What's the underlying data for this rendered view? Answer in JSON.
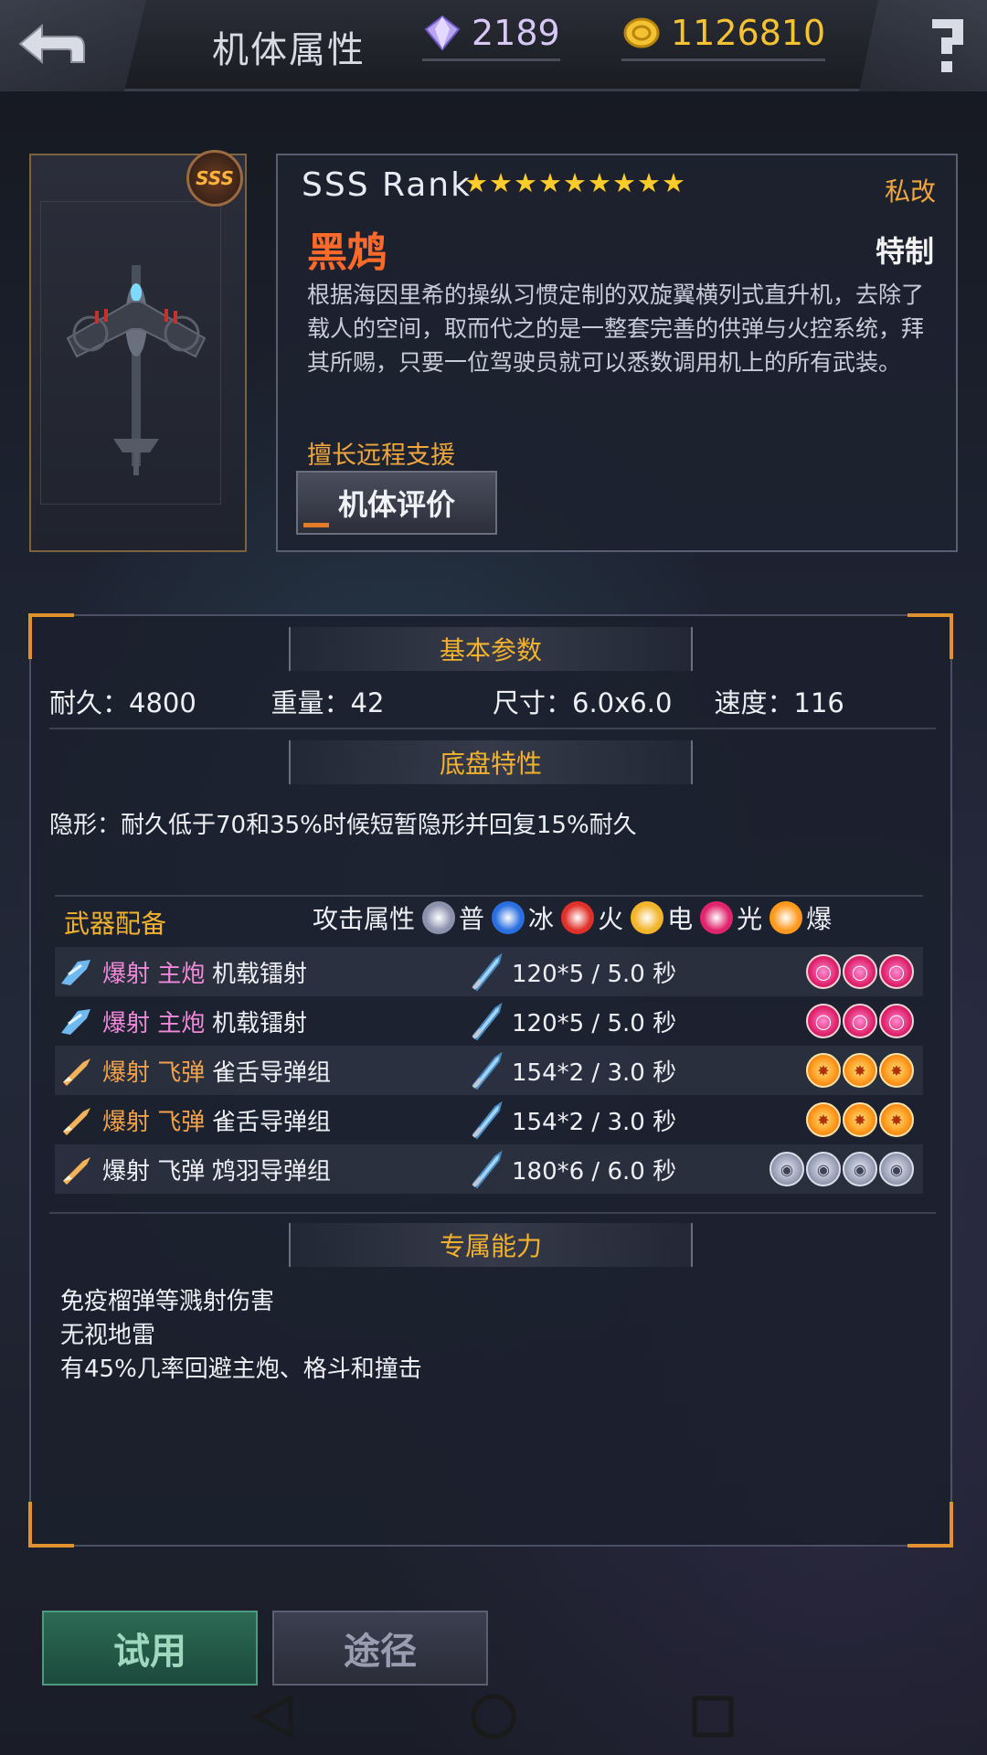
{
  "topbar": {
    "title": "机体属性",
    "gems": "2189",
    "coins": "1126810"
  },
  "unit": {
    "rank_badge": "SSS",
    "rank_text": "SSS Rank",
    "stars": 9,
    "mod_tag": "私改",
    "name": "黑鸩",
    "grade": "特制",
    "description": "根据海因里希的操纵习惯定制的双旋翼横列式直升机，去除了载人的空间，取而代之的是一整套完善的供弹与火控系统，拜其所赐，只要一位驾驶员就可以悉数调用机上的所有武装。",
    "specialty": "擅长远程支援",
    "eval_button": "机体评价"
  },
  "basic": {
    "heading": "基本参数",
    "durability": "耐久：4800",
    "weight": "重量：42",
    "size": "尺寸：6.0x6.0",
    "speed": "速度：116"
  },
  "chassis": {
    "heading": "底盘特性",
    "text": "隐形：耐久低于70和35%时候短暂隐形并回复15%耐久"
  },
  "weapons": {
    "heading": "武器配备",
    "attack_label": "攻击属性",
    "elements": [
      {
        "label": "普",
        "icon": "normal-element-icon",
        "color": "#8c92ad"
      },
      {
        "label": "冰",
        "icon": "ice-element-icon",
        "color": "#2a6fe0"
      },
      {
        "label": "火",
        "icon": "fire-element-icon",
        "color": "#e0302a"
      },
      {
        "label": "电",
        "icon": "electric-element-icon",
        "color": "#f2b52a"
      },
      {
        "label": "光",
        "icon": "light-element-icon",
        "color": "#e0246e"
      },
      {
        "label": "爆",
        "icon": "blast-element-icon",
        "color": "#ff9a1e"
      }
    ],
    "rows": [
      {
        "type": "爆射 主炮",
        "type_color": "#f08ad8",
        "icon": "main-cannon-icon",
        "name": "机载镭射",
        "damage": "120*5 / 5.0 秒",
        "orb_type": "light",
        "orbs": 3
      },
      {
        "type": "爆射 主炮",
        "type_color": "#f08ad8",
        "icon": "main-cannon-icon",
        "name": "机载镭射",
        "damage": "120*5 / 5.0 秒",
        "orb_type": "light",
        "orbs": 3
      },
      {
        "type": "爆射 飞弹",
        "type_color": "#f2a24a",
        "icon": "missile-icon",
        "name": "雀舌导弹组",
        "damage": "154*2 / 3.0 秒",
        "orb_type": "blast",
        "orbs": 3
      },
      {
        "type": "爆射 飞弹",
        "type_color": "#f2a24a",
        "icon": "missile-icon",
        "name": "雀舌导弹组",
        "damage": "154*2 / 3.0 秒",
        "orb_type": "blast",
        "orbs": 3
      },
      {
        "type": "爆射 飞弹",
        "type_color": "#eef0f5",
        "icon": "missile-icon",
        "name": "鸩羽导弹组",
        "damage": "180*6 / 6.0 秒",
        "orb_type": "normal",
        "orbs": 4
      }
    ]
  },
  "exclusive": {
    "heading": "专属能力",
    "items": [
      "免疫榴弹等溅射伤害",
      "无视地雷",
      "有45%几率回避主炮、格斗和撞击"
    ]
  },
  "actions": {
    "trial": "试用",
    "route": "途径"
  },
  "colors": {
    "accent_orange": "#e0922e",
    "heading_gold": "#f2b22d",
    "unit_name": "#ff6a2a",
    "coin": "#f4c233"
  }
}
